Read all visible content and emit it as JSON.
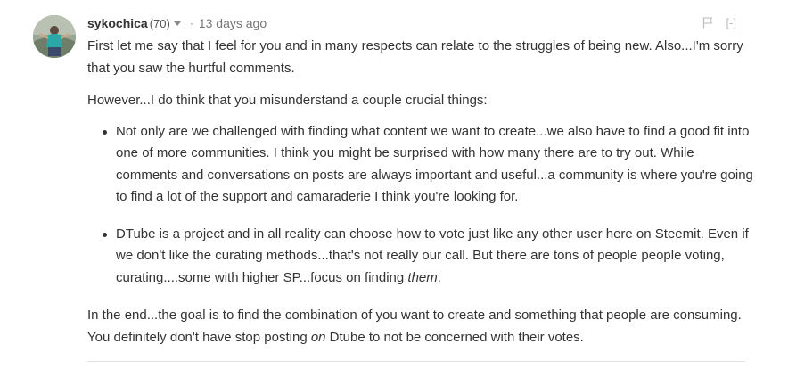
{
  "comment": {
    "author": "sykochica",
    "reputation": "(70)",
    "separator": "·",
    "timestamp": "13 days ago",
    "collapse_label": "[-]",
    "body": {
      "p1": "First let me say that I feel for you and in many respects can relate to the struggles of being new. Also...I'm sorry that you saw the hurtful comments.",
      "p2": "However...I do think that you misunderstand a couple crucial things:",
      "bullets": [
        {
          "text": "Not only are we challenged with finding what content we want to create...we also have to find a good fit into one of more communities. I think you might be surprised with how many there are to try out. While comments and conversations on posts are always important and useful...a community is where you're going to find a lot of the support and camaraderie I think you're looking for."
        },
        {
          "text_before": "DTube is a project and in all reality can choose how to vote just like any other user here on Steemit. Even if we don't like the curating methods...that's not really our call. But there are tons of people people voting, curating....some with higher SP...focus on finding ",
          "em": "them",
          "text_after": "."
        }
      ],
      "p3": {
        "text_before": "In the end...the goal is to find the combination of you want to create and something that people are consuming. You definitely don't have stop posting ",
        "em": "on",
        "text_after": " Dtube to not be concerned with their votes."
      }
    }
  },
  "icons": {
    "avatar": "user-avatar",
    "caret": "chevron-down-icon",
    "flag": "flag-icon"
  },
  "colors": {
    "text": "#333333",
    "muted": "#777777",
    "action": "#bbbbbb",
    "divider": "#e1e1e1"
  }
}
